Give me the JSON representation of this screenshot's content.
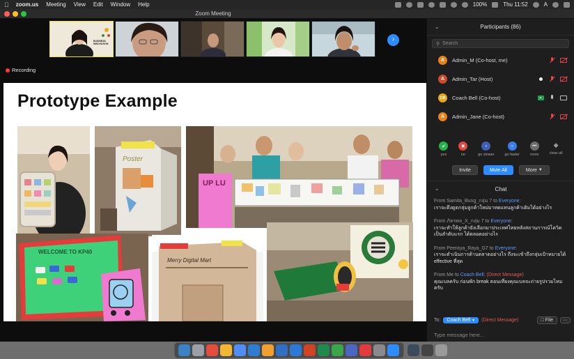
{
  "menubar": {
    "app": "zoom.us",
    "items": [
      "Meeting",
      "View",
      "Edit",
      "Window",
      "Help"
    ],
    "battery": "100%",
    "clock": "Thu 11:52",
    "input_letter": "A"
  },
  "window": {
    "title": "Zoom Meeting"
  },
  "video": {
    "recording_label": "Recording",
    "thumbnail_logo": "BUSINESS INNOVATION",
    "slide_title": "Prototype Example",
    "photo_texts": {
      "poster": "Poster",
      "uplu": "UP LU",
      "welcome": "WELCOME TO KP40",
      "mart": "Merry Digital Mart"
    }
  },
  "participants": {
    "header": "Participants (86)",
    "search_placeholder": "Search",
    "list": [
      {
        "initials": "A",
        "name": "Admin_M (Co-host, me)",
        "color": "orange"
      },
      {
        "initials": "A",
        "name": "Admin_Tar (Host)",
        "color": "red"
      },
      {
        "initials": "CB",
        "name": "Coach Bell (Co-host)",
        "color": "yellow"
      },
      {
        "initials": "A",
        "name": "Admin_Jane (Co-host)",
        "color": "orange"
      }
    ],
    "reactions": [
      {
        "label": "yes",
        "glyph": "✔"
      },
      {
        "label": "no",
        "glyph": "✖"
      },
      {
        "label": "go slower",
        "glyph": "«"
      },
      {
        "label": "go faster",
        "glyph": "»"
      },
      {
        "label": "more",
        "glyph": "•••"
      },
      {
        "label": "clear all",
        "glyph": "◆"
      }
    ],
    "buttons": {
      "invite": "Invite",
      "mute_all": "Mute All",
      "more": "More"
    }
  },
  "chat": {
    "header": "Chat",
    "messages": [
      {
        "from": "From Samita_Bung_กลุ่ม 7 to",
        "to": "Everyone",
        "type": "everyone",
        "body": "เราจะดึงดูดกลุ่มลูกค้าใหม่มาทดแทนลูกค้าเดิมได้อย่างไร"
      },
      {
        "from": "From ภัทรพล_X_กลุ่ม 7 to",
        "to": "Everyone",
        "type": "everyone",
        "body": "เราจะทำให้ลูกค้ายังเลือกมาประเทศไทยหลังสถานการณ์โควิดเป็นลำดับแรก ได้ตลอดอย่างไร"
      },
      {
        "from": "From Peeraya_Raya_G7 to",
        "to": "Everyone",
        "type": "everyone",
        "body": "เราจะดำเนินการด้านตลาดอย่างไร ถึงจะเข้าถึงกลุ่มเป้าหมายได้ effective ที่สุด"
      },
      {
        "from": "From Me to",
        "to": "Coach Bell",
        "to_suffix": "(Direct Message)",
        "type": "dm",
        "body": "คุณเบลครับ ก่อนพัก break ตอนเที่ยงคุณเบลจะถ่ายรูปรวมไหมครับ"
      }
    ],
    "to_label": "To:",
    "recipient": "Coach Bell",
    "recipient_note": "(Direct Message)",
    "file_button": "File",
    "more_button": "···",
    "input_placeholder": "Type message here..."
  },
  "dock": {
    "colors": [
      "#3b82c4",
      "#9aa0a6",
      "#e44c3c",
      "#f2b632",
      "#4f8ef7",
      "#2d7dd2",
      "#f0a030",
      "#2f6fc4",
      "#2b78d6",
      "#d04423",
      "#1f8a4c",
      "#3aa64a",
      "#4b67c4",
      "#e23b3b",
      "#8a8a8a",
      "#2d8cff",
      "#3c4b5c",
      "#444444",
      "#9a9a9a"
    ]
  }
}
